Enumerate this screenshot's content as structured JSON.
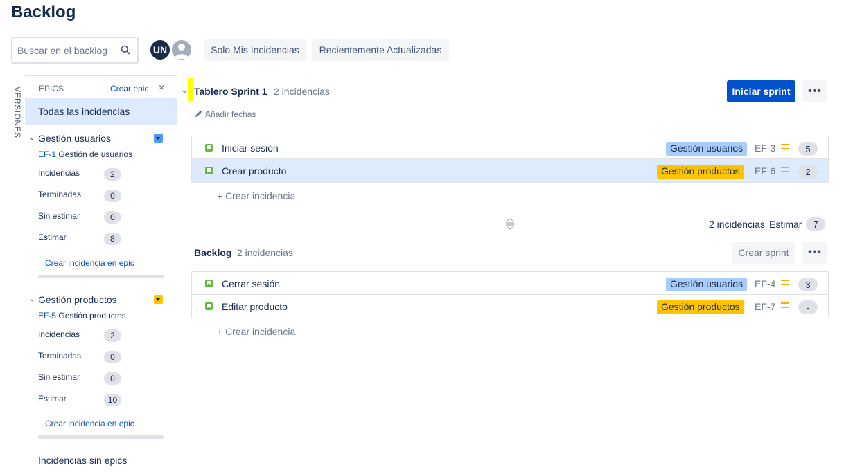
{
  "page": {
    "title": "Backlog"
  },
  "toolbar": {
    "search_placeholder": "Buscar en el backlog",
    "avatar_initials": "UN",
    "filter_mine": "Solo Mis Incidencias",
    "filter_recent": "Recientemente Actualizadas"
  },
  "sidebar": {
    "versions_tab": "VERSIONES",
    "epics_header": "EPICS",
    "create_epic": "Crear epic",
    "close": "×",
    "all_issues": "Todas las incidencias",
    "epics": [
      {
        "title": "Gestión usuarios",
        "key": "EF-1",
        "key_name": "Gestión de usuarios",
        "color": "#4c9aff",
        "stats": [
          {
            "label": "Incidencias",
            "value": "2"
          },
          {
            "label": "Terminadas",
            "value": "0"
          },
          {
            "label": "Sin estimar",
            "value": "0"
          },
          {
            "label": "Estimar",
            "value": "8"
          }
        ],
        "create_link": "Crear incidencia en epic"
      },
      {
        "title": "Gestión productos",
        "key": "EF-5",
        "key_name": "Gestión productos",
        "color": "#ffc400",
        "stats": [
          {
            "label": "Incidencias",
            "value": "2"
          },
          {
            "label": "Terminadas",
            "value": "0"
          },
          {
            "label": "Sin estimar",
            "value": "0"
          },
          {
            "label": "Estimar",
            "value": "10"
          }
        ],
        "create_link": "Crear incidencia en epic"
      }
    ],
    "no_epic": "Incidencias sin epics"
  },
  "sprint": {
    "name": "Tablero Sprint 1",
    "count": "2 incidencias",
    "add_dates": "Añadir fechas",
    "start_button": "Iniciar sprint",
    "more": "•••",
    "issues": [
      {
        "summary": "Iniciar sesión",
        "epic": "Gestión usuarios",
        "epic_color": "blue",
        "key": "EF-3",
        "priority": "medium",
        "estimate": "5"
      },
      {
        "summary": "Crear producto",
        "epic": "Gestión productos",
        "epic_color": "yellow",
        "key": "EF-6",
        "priority": "medium",
        "estimate": "2"
      }
    ],
    "create_issue": "+   Crear incidencia",
    "footer_count": "2 incidencias",
    "footer_estimate_label": "Estimar",
    "footer_estimate": "7"
  },
  "backlog": {
    "name": "Backlog",
    "count": "2 incidencias",
    "create_sprint": "Crear sprint",
    "more": "•••",
    "issues": [
      {
        "summary": "Cerrar sesión",
        "epic": "Gestión usuarios",
        "epic_color": "blue",
        "key": "EF-4",
        "priority": "medium",
        "estimate": "3"
      },
      {
        "summary": "Editar producto",
        "epic": "Gestión productos",
        "epic_color": "yellow",
        "key": "EF-7",
        "priority": "medium",
        "estimate": "-"
      }
    ],
    "create_issue": "+   Crear incidencia"
  }
}
